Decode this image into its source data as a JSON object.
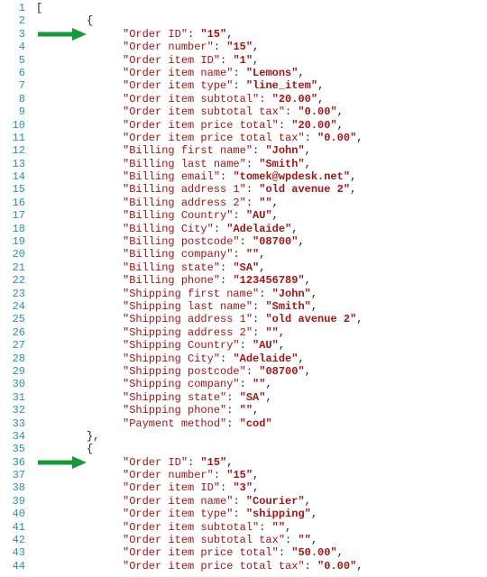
{
  "arrows": {
    "a1_line": 3,
    "a2_line": 36
  },
  "lines": [
    {
      "n": 1,
      "type": "raw",
      "indent": 0,
      "text": "["
    },
    {
      "n": 2,
      "type": "raw",
      "indent": 1,
      "text": "{"
    },
    {
      "n": 3,
      "type": "kv",
      "indent": 2,
      "key": "Order ID",
      "val": "15",
      "comma": true
    },
    {
      "n": 4,
      "type": "kv",
      "indent": 2,
      "key": "Order number",
      "val": "15",
      "comma": true
    },
    {
      "n": 5,
      "type": "kv",
      "indent": 2,
      "key": "Order item ID",
      "val": "1",
      "comma": true
    },
    {
      "n": 6,
      "type": "kv",
      "indent": 2,
      "key": "Order item name",
      "val": "Lemons",
      "comma": true
    },
    {
      "n": 7,
      "type": "kv",
      "indent": 2,
      "key": "Order item type",
      "val": "line_item",
      "comma": true
    },
    {
      "n": 8,
      "type": "kv",
      "indent": 2,
      "key": "Order item subtotal",
      "val": "20.00",
      "comma": true
    },
    {
      "n": 9,
      "type": "kv",
      "indent": 2,
      "key": "Order item subtotal tax",
      "val": "0.00",
      "comma": true
    },
    {
      "n": 10,
      "type": "kv",
      "indent": 2,
      "key": "Order item price total",
      "val": "20.00",
      "comma": true
    },
    {
      "n": 11,
      "type": "kv",
      "indent": 2,
      "key": "Order item price total tax",
      "val": "0.00",
      "comma": true
    },
    {
      "n": 12,
      "type": "kv",
      "indent": 2,
      "key": "Billing first name",
      "val": "John",
      "comma": true
    },
    {
      "n": 13,
      "type": "kv",
      "indent": 2,
      "key": "Billing last name",
      "val": "Smith",
      "comma": true
    },
    {
      "n": 14,
      "type": "kv",
      "indent": 2,
      "key": "Billing email",
      "val": "tomek@wpdesk.net",
      "comma": true
    },
    {
      "n": 15,
      "type": "kv",
      "indent": 2,
      "key": "Billing address 1",
      "val": "old avenue 2",
      "comma": true
    },
    {
      "n": 16,
      "type": "kv",
      "indent": 2,
      "key": "Billing address 2",
      "val": "",
      "comma": true
    },
    {
      "n": 17,
      "type": "kv",
      "indent": 2,
      "key": "Billing Country",
      "val": "AU",
      "comma": true
    },
    {
      "n": 18,
      "type": "kv",
      "indent": 2,
      "key": "Billing City",
      "val": "Adelaide",
      "comma": true
    },
    {
      "n": 19,
      "type": "kv",
      "indent": 2,
      "key": "Billing postcode",
      "val": "08700",
      "comma": true
    },
    {
      "n": 20,
      "type": "kv",
      "indent": 2,
      "key": "Billing company",
      "val": "",
      "comma": true
    },
    {
      "n": 21,
      "type": "kv",
      "indent": 2,
      "key": "Billing state",
      "val": "SA",
      "comma": true
    },
    {
      "n": 22,
      "type": "kv",
      "indent": 2,
      "key": "Billing phone",
      "val": "123456789",
      "comma": true
    },
    {
      "n": 23,
      "type": "kv",
      "indent": 2,
      "key": "Shipping first name",
      "val": "John",
      "comma": true
    },
    {
      "n": 24,
      "type": "kv",
      "indent": 2,
      "key": "Shipping last name",
      "val": "Smith",
      "comma": true
    },
    {
      "n": 25,
      "type": "kv",
      "indent": 2,
      "key": "Shipping address 1",
      "val": "old avenue 2",
      "comma": true
    },
    {
      "n": 26,
      "type": "kv",
      "indent": 2,
      "key": "Shipping address 2",
      "val": "",
      "comma": true
    },
    {
      "n": 27,
      "type": "kv",
      "indent": 2,
      "key": "Shipping Country",
      "val": "AU",
      "comma": true
    },
    {
      "n": 28,
      "type": "kv",
      "indent": 2,
      "key": "Shipping City",
      "val": "Adelaide",
      "comma": true
    },
    {
      "n": 29,
      "type": "kv",
      "indent": 2,
      "key": "Shipping postcode",
      "val": "08700",
      "comma": true
    },
    {
      "n": 30,
      "type": "kv",
      "indent": 2,
      "key": "Shipping company",
      "val": "",
      "comma": true
    },
    {
      "n": 31,
      "type": "kv",
      "indent": 2,
      "key": "Shipping state",
      "val": "SA",
      "comma": true
    },
    {
      "n": 32,
      "type": "kv",
      "indent": 2,
      "key": "Shipping phone",
      "val": "",
      "comma": true
    },
    {
      "n": 33,
      "type": "kv",
      "indent": 2,
      "key": "Payment method",
      "val": "cod",
      "comma": false
    },
    {
      "n": 34,
      "type": "raw",
      "indent": 1,
      "text": "},"
    },
    {
      "n": 35,
      "type": "raw",
      "indent": 1,
      "text": "{"
    },
    {
      "n": 36,
      "type": "kv",
      "indent": 2,
      "key": "Order ID",
      "val": "15",
      "comma": true
    },
    {
      "n": 37,
      "type": "kv",
      "indent": 2,
      "key": "Order number",
      "val": "15",
      "comma": true
    },
    {
      "n": 38,
      "type": "kv",
      "indent": 2,
      "key": "Order item ID",
      "val": "3",
      "comma": true
    },
    {
      "n": 39,
      "type": "kv",
      "indent": 2,
      "key": "Order item name",
      "val": "Courier",
      "comma": true
    },
    {
      "n": 40,
      "type": "kv",
      "indent": 2,
      "key": "Order item type",
      "val": "shipping",
      "comma": true
    },
    {
      "n": 41,
      "type": "kv",
      "indent": 2,
      "key": "Order item subtotal",
      "val": "",
      "comma": true
    },
    {
      "n": 42,
      "type": "kv",
      "indent": 2,
      "key": "Order item subtotal tax",
      "val": "",
      "comma": true
    },
    {
      "n": 43,
      "type": "kv",
      "indent": 2,
      "key": "Order item price total",
      "val": "50.00",
      "comma": true
    },
    {
      "n": 44,
      "type": "kv",
      "indent": 2,
      "key": "Order item price total tax",
      "val": "0.00",
      "comma": true
    }
  ]
}
